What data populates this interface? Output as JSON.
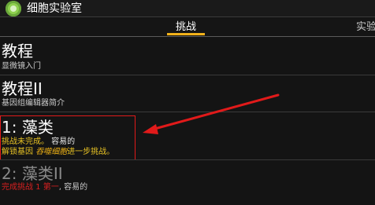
{
  "app": {
    "title": "细胞实验室"
  },
  "tabs": [
    {
      "label": "挑战",
      "active": true
    },
    {
      "label": "实验",
      "active": false
    }
  ],
  "items": [
    {
      "title": "教程",
      "subtitle": "显微镜入门"
    },
    {
      "title": "教程II",
      "subtitle": "基因组编辑器简介"
    },
    {
      "title": "1: 藻类",
      "status_yellow": "挑战未完成。",
      "status_rest": " 容易的",
      "unlock_prefix": "解锁基因 ",
      "unlock_gene": "吞噬细胞",
      "unlock_suffix": "进一步挑战。"
    },
    {
      "title": "2: 藻类II",
      "sub_red": "完成挑战 1 第一",
      "sub_rest": ", 容易的"
    }
  ],
  "colors": {
    "accent": "#f2b21b",
    "highlight_box": "#e11a1a",
    "annotation_arrow": "#e11a1a"
  }
}
